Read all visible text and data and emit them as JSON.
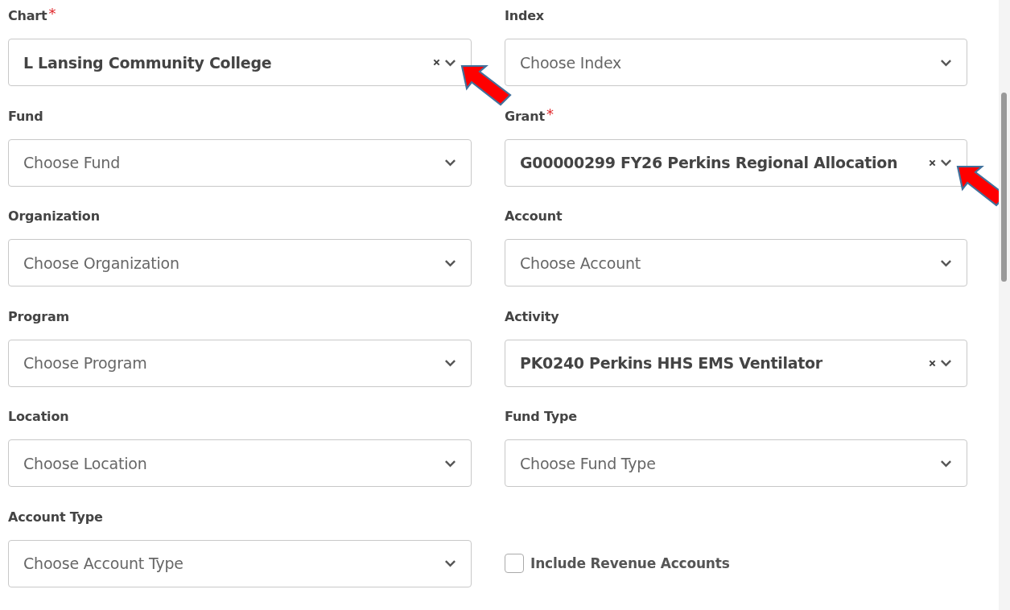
{
  "fields": [
    {
      "kind": "select",
      "label": "Chart",
      "required_mark": "*",
      "value": "L Lansing Community College",
      "arrow": true
    },
    {
      "kind": "select",
      "label": "Index",
      "placeholder": "Choose Index",
      "arrow": false
    },
    {
      "kind": "select",
      "label": "Fund",
      "placeholder": "Choose Fund",
      "arrow": false
    },
    {
      "kind": "select",
      "label": "Grant",
      "required_mark": "*",
      "value": "G00000299 FY26 Perkins Regional Allocation",
      "arrow": true
    },
    {
      "kind": "select",
      "label": "Organization",
      "placeholder": "Choose Organization",
      "arrow": false
    },
    {
      "kind": "select",
      "label": "Account",
      "placeholder": "Choose Account",
      "arrow": false
    },
    {
      "kind": "select",
      "label": "Program",
      "placeholder": "Choose Program",
      "arrow": false
    },
    {
      "kind": "select",
      "label": "Activity",
      "value": "PK0240 Perkins HHS EMS Ventilator",
      "arrow": false
    },
    {
      "kind": "select",
      "label": "Location",
      "placeholder": "Choose Location",
      "arrow": false
    },
    {
      "kind": "select",
      "label": "Fund Type",
      "placeholder": "Choose Fund Type",
      "arrow": false
    },
    {
      "kind": "select",
      "label": "Account Type",
      "placeholder": "Choose Account Type",
      "arrow": false
    },
    {
      "kind": "checkbox",
      "label": "Include Revenue Accounts",
      "checked": false
    }
  ]
}
